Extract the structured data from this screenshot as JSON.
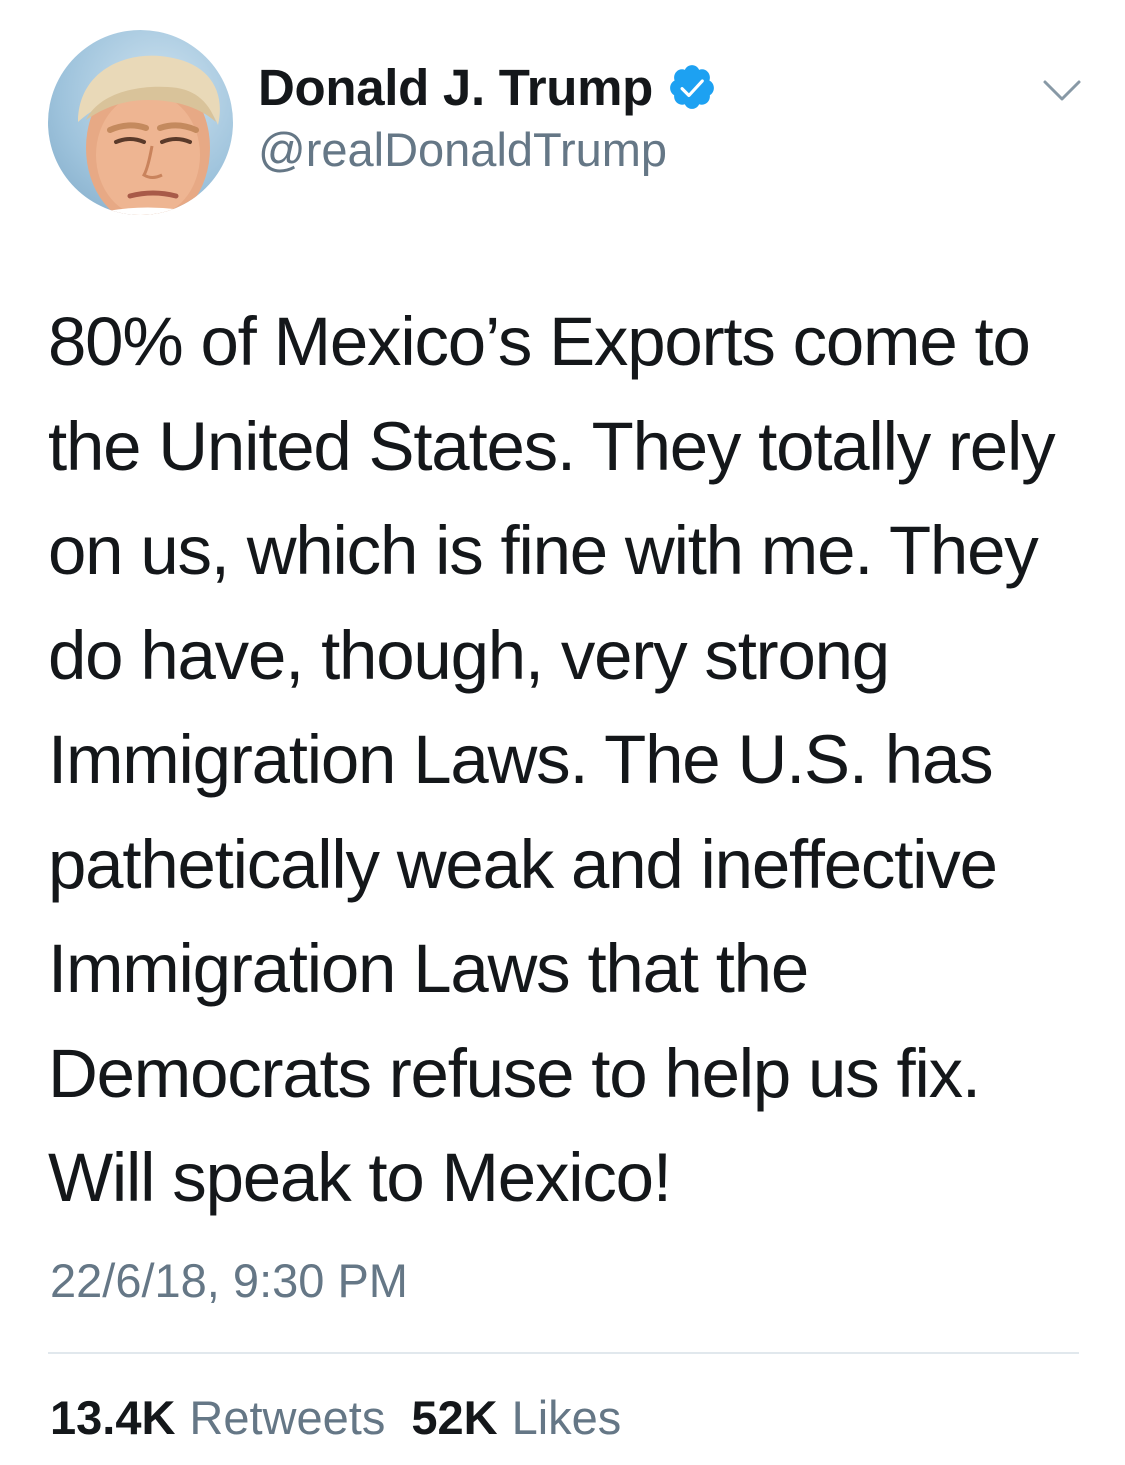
{
  "author": {
    "display_name": "Donald J. Trump",
    "handle": "@realDonaldTrump",
    "verified": true,
    "avatar_icon": "profile-photo"
  },
  "menu_icon": "chevron-down-icon",
  "tweet": {
    "lines": [
      "80% of Mexico’s Exports come to",
      "the United States. They totally rely",
      "on us, which is fine with me. They",
      "do have, though, very strong",
      "Immigration Laws. The U.S. has",
      "pathetically weak and ineffective",
      "Immigration Laws that the",
      "Democrats refuse to help us fix.",
      "Will speak to Mexico!"
    ],
    "timestamp": "22/6/18, 9:30 PM"
  },
  "stats": {
    "retweets_count": "13.4K",
    "retweets_label": "Retweets",
    "likes_count": "52K",
    "likes_label": "Likes"
  },
  "colors": {
    "text": "#14171a",
    "secondary": "#657786",
    "verified": "#1da1f2",
    "divider": "#e1e8ed"
  }
}
